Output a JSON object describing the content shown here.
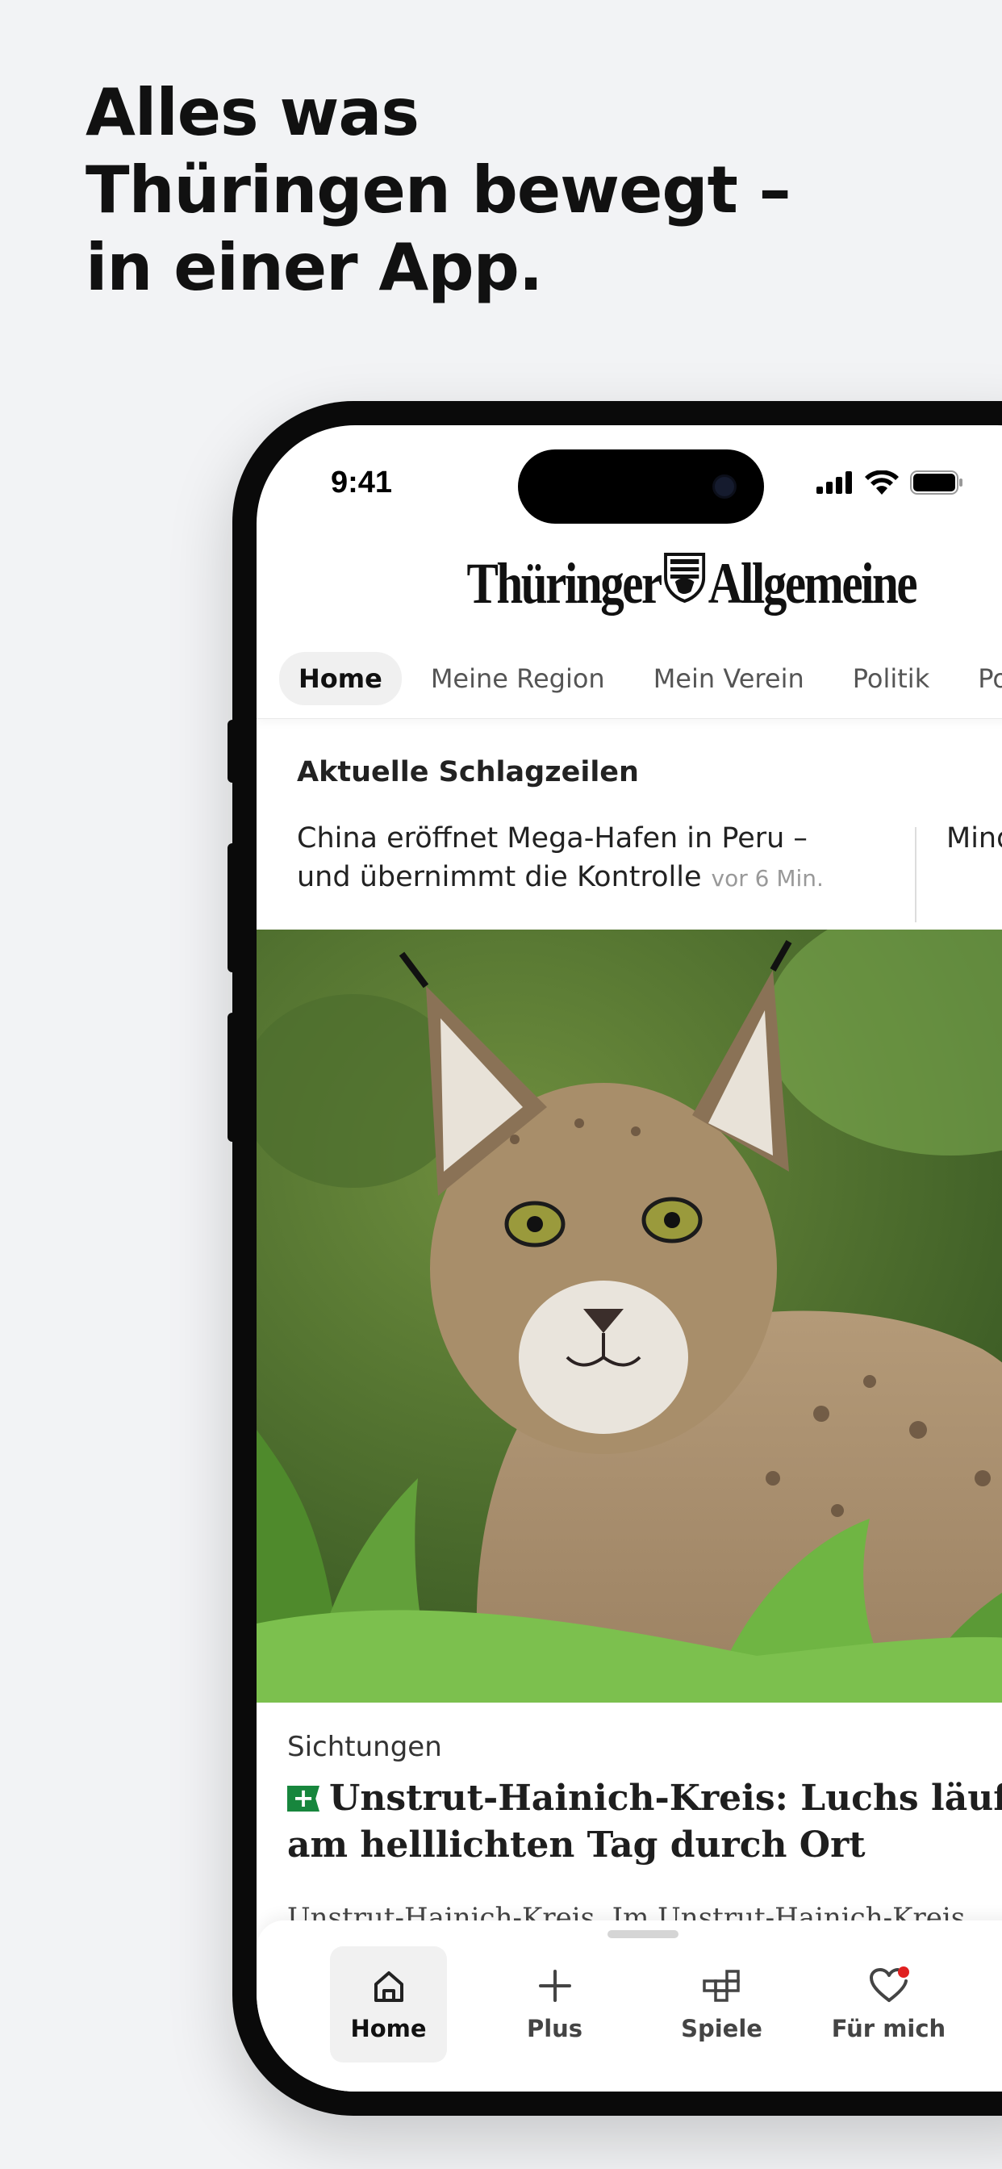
{
  "promo": {
    "headline_lines": [
      "Alles was",
      "Thüringen bewegt –",
      "in einer App."
    ]
  },
  "status_bar": {
    "time": "9:41",
    "icons": [
      "cellular-signal-icon",
      "wifi-icon",
      "battery-icon"
    ]
  },
  "app": {
    "logo_left": "Thüringer",
    "logo_right": "Allgemeine",
    "logo_crest_icon": "thuringia-crest-icon"
  },
  "tabs": [
    {
      "label": "Home",
      "active": true
    },
    {
      "label": "Meine Region",
      "active": false
    },
    {
      "label": "Mein Verein",
      "active": false
    },
    {
      "label": "Politik",
      "active": false
    },
    {
      "label": "Polizei",
      "active": false
    }
  ],
  "headlines_section": {
    "title": "Aktuelle Schlagzeilen",
    "items": [
      {
        "text": "China eröffnet Mega-Hafen in Peru – und übernimmt die Kontrolle",
        "time": "vor 6 Min."
      },
      {
        "text": "Mindes… spanis…"
      }
    ]
  },
  "article": {
    "kicker": "Sichtungen",
    "plus_badge": "+",
    "title": "Unstrut-Hainich-Kreis: Luchs läuft am helllichten Tag durch Ort",
    "teaser": "Unstrut-Hainich-Kreis. Im Unstrut-Hainich-Kreis"
  },
  "bottom_nav": [
    {
      "label": "Home",
      "icon": "home-icon",
      "active": true
    },
    {
      "label": "Plus",
      "icon": "plus-icon",
      "active": false
    },
    {
      "label": "Spiele",
      "icon": "puzzle-icon",
      "active": false
    },
    {
      "label": "Für mich",
      "icon": "heart-icon",
      "active": false,
      "notification": true
    }
  ],
  "colors": {
    "background": "#f2f3f5",
    "plus_badge": "#17863d",
    "notification_dot": "#e02020"
  }
}
